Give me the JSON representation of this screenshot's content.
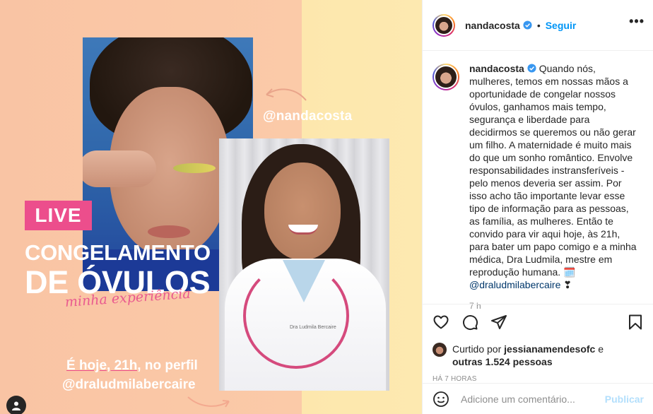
{
  "image": {
    "handle_overlay": "@nandacosta",
    "live_label": "LIVE",
    "title_line1": "CONGELAMENTO",
    "title_line2": "DE ÓVULOS",
    "title_script": "minha experiência",
    "cta_prefix": "É hoje, 21h,",
    "cta_suffix": " no perfil",
    "cta_handle": "@draludmilabercaire",
    "doctor_badge": "Dra Ludmila Bercaire",
    "colors": {
      "peach": "#fbcaa8",
      "yellow": "#fde7ad",
      "pink": "#ec4e8c"
    }
  },
  "header": {
    "username": "nandacosta",
    "separator": "•",
    "follow_label": "Seguir",
    "more_label": "•••"
  },
  "caption": {
    "username": "nandacosta",
    "text": " Quando nós, mulheres, temos em nossas mãos a oportunidade de congelar nossos óvulos, ganhamos mais tempo, segurança e liberdade para decidirmos se queremos ou não gerar um filho. A maternidade é muito mais do que um sonho romântico. Envolve responsabilidades instransferíveis - pelo menos deveria ser assim. Por isso acho tão importante levar esse tipo de informação para as pessoas, as família, as mulheres. Então te convido para vir aqui hoje, às 21h, para bater um papo comigo e a minha médica, Dra Ludmila, mestre em reprodução humana. ",
    "emoji": "🗓️",
    "mention": "@draludmilabercaire",
    "heart": " ❣",
    "time": "7 h"
  },
  "actions": {
    "liked_prefix": "Curtido por ",
    "liked_user": "jessianamendesofc",
    "liked_mid": " e",
    "liked_others": "outras 1.524 pessoas",
    "ago": "HÁ 7 HORAS"
  },
  "comment": {
    "placeholder": "Adicione um comentário...",
    "publish_label": "Publicar"
  }
}
